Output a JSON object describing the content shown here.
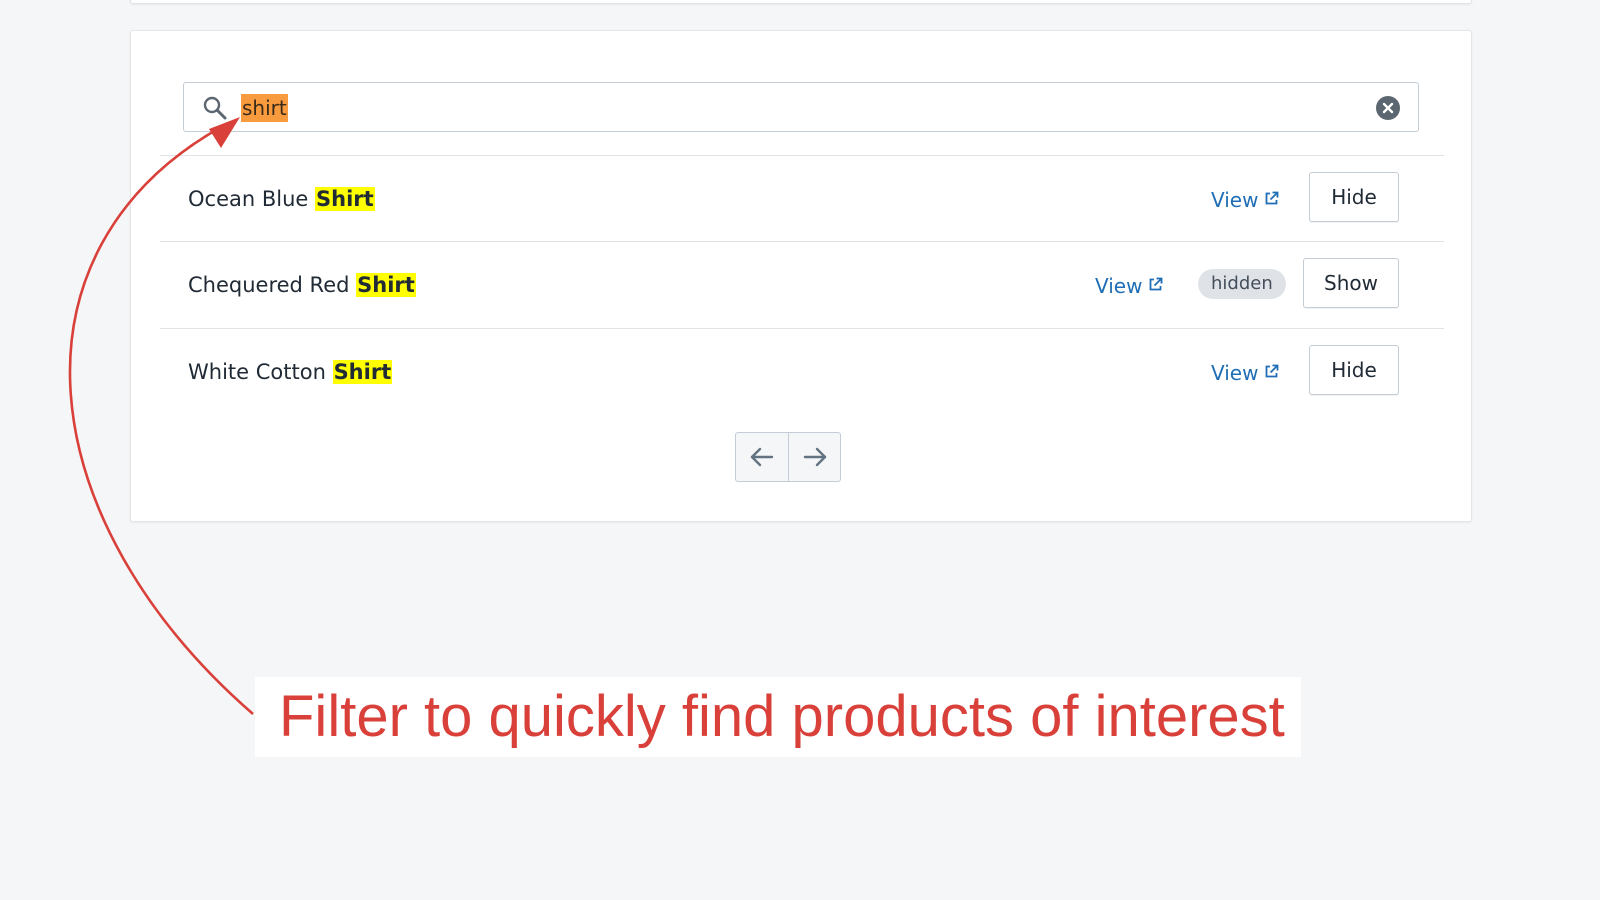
{
  "search": {
    "value": "shirt"
  },
  "products": [
    {
      "name_prefix": "Ocean Blue ",
      "name_match": "Shirt",
      "view_label": "View",
      "badge": "",
      "action_label": "Hide"
    },
    {
      "name_prefix": "Chequered Red ",
      "name_match": "Shirt",
      "view_label": "View",
      "badge": "hidden",
      "action_label": "Show"
    },
    {
      "name_prefix": "White Cotton ",
      "name_match": "Shirt",
      "view_label": "View",
      "badge": "",
      "action_label": "Hide"
    }
  ],
  "pagination": {
    "prev_icon": "arrow-left-icon",
    "next_icon": "arrow-right-icon"
  },
  "annotation": {
    "text": "Filter to quickly find products of interest",
    "color": "#d9403a"
  },
  "colors": {
    "search_highlight": "#f89b3e",
    "match_highlight": "#ffff00",
    "link": "#1f6eb5"
  }
}
